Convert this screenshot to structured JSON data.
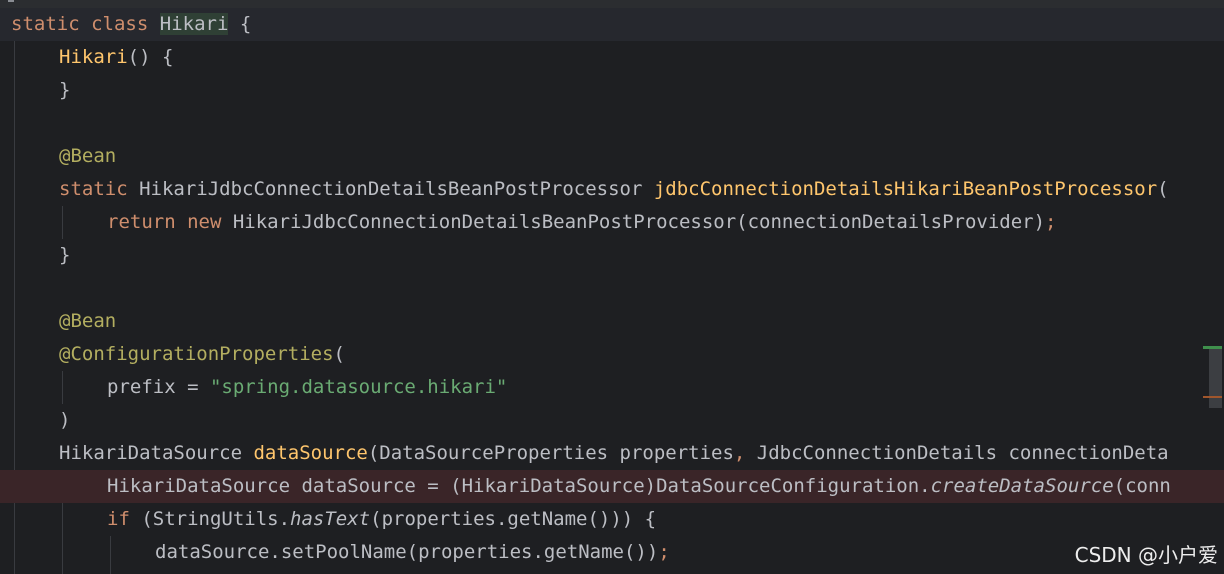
{
  "editor": {
    "lines": [
      {
        "text": "static class Hikari {"
      },
      {
        "text": "Hikari() {"
      },
      {
        "text": "}"
      },
      {
        "text": ""
      },
      {
        "text": "@Bean"
      },
      {
        "text": "static HikariJdbcConnectionDetailsBeanPostProcessor jdbcConnectionDetailsHikariBeanPostProcessor("
      },
      {
        "text": "return new HikariJdbcConnectionDetailsBeanPostProcessor(connectionDetailsProvider);"
      },
      {
        "text": "}"
      },
      {
        "text": ""
      },
      {
        "text": "@Bean"
      },
      {
        "text": "@ConfigurationProperties("
      },
      {
        "text": "prefix = \"spring.datasource.hikari\""
      },
      {
        "text": ")"
      },
      {
        "text": "HikariDataSource dataSource(DataSourceProperties properties, JdbcConnectionDetails connectionDeta"
      },
      {
        "text": "HikariDataSource dataSource = (HikariDataSource)DataSourceConfiguration.createDataSource(conn"
      },
      {
        "text": "if (StringUtils.hasText(properties.getName())) {"
      },
      {
        "text": "dataSource.setPoolName(properties.getName());"
      }
    ]
  },
  "watermark": {
    "text": "CSDN @小户爱"
  },
  "colors": {
    "background": "#1e1f22",
    "keyword": "#cf8e6d",
    "method_declaration": "#ffc66d",
    "annotation": "#b3ae60",
    "string": "#6aab73",
    "plain": "#bcbec4"
  }
}
